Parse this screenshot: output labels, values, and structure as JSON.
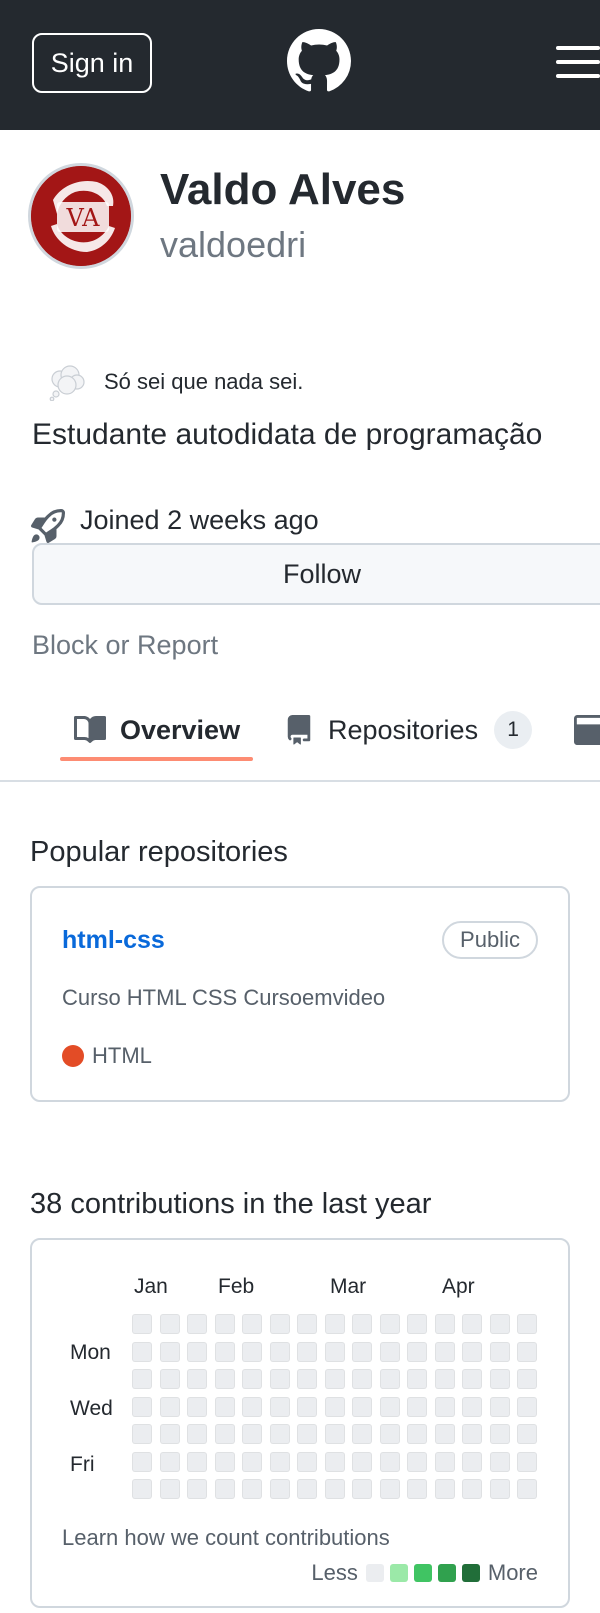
{
  "header": {
    "sign_in_label": "Sign in",
    "logo_icon": "github-octocat-icon",
    "menu_icon": "hamburger-menu-icon"
  },
  "profile": {
    "name": "Valdo Alves",
    "login": "valdoedri",
    "avatar_text": "VA",
    "status_emoji": "thought-balloon-icon",
    "status_text": "Só sei que nada sei.",
    "bio": "Estudante autodidata de programação",
    "joined_text": "Joined 2 weeks ago",
    "follow_label": "Follow",
    "block_label": "Block or Report"
  },
  "tabs": [
    {
      "label": "Overview",
      "icon": "book-icon",
      "selected": true
    },
    {
      "label": "Repositories",
      "icon": "repo-icon",
      "count": "1"
    },
    {
      "label": "",
      "icon": "project-icon"
    }
  ],
  "popular": {
    "title": "Popular repositories",
    "repos": [
      {
        "name": "html-css",
        "visibility": "Public",
        "description": "Curso HTML CSS Cursoemvideo",
        "language": "HTML",
        "language_color": "#e34c26"
      }
    ]
  },
  "contributions": {
    "title": "38 contributions in the last year",
    "months": [
      "Jan",
      "Feb",
      "Mar",
      "Apr"
    ],
    "days": [
      "Mon",
      "Wed",
      "Fri"
    ],
    "learn_link": "Learn how we count contributions",
    "legend_less": "Less",
    "legend_more": "More",
    "legend_colors": [
      "#ebedf0",
      "#9be9a8",
      "#40c463",
      "#30a14e",
      "#216e39"
    ],
    "empty_color": "#ebedf0"
  },
  "colors": {
    "header_bg": "#24292f",
    "link": "#0969da",
    "tab_underline": "#fd8c73"
  }
}
